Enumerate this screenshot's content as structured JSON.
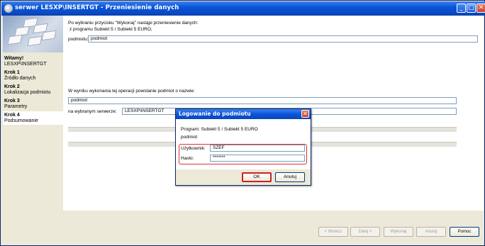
{
  "window": {
    "title": "serwer LESXP\\INSERTGT - Przeniesienie danych"
  },
  "sidebar": {
    "welcome_title": "Witamy!",
    "welcome_sub": "LESXP\\INSERTGT",
    "steps": [
      {
        "title": "Krok 1",
        "label": "Źródło danych"
      },
      {
        "title": "Krok 2",
        "label": "Lokalizacja podmiotu"
      },
      {
        "title": "Krok 3",
        "label": "Parametry"
      },
      {
        "title": "Krok 4",
        "label": "Podsumowanie"
      }
    ],
    "active_step": 4
  },
  "main": {
    "intro_line": "Po wybraniu przycisku \"Wykonaj\" nastąpi przeniesienie danych:",
    "source_line": "z programu Subiekt 5 / Subiekt 5 EURO,",
    "podmiot_label": "podmiotu:",
    "podmiot_value": "podmiot",
    "result_line": "W wyniku wykonania tej operacji powstanie podmiot o nazwie:",
    "new_name_value": "podmiot",
    "server_label": "na wybranym serwerze:",
    "server_value": "LESXP\\INSERTGT"
  },
  "nav": {
    "back": "< Wstecz",
    "next": "Dalej >",
    "execute": "Wykonaj",
    "cancel": "Anuluj",
    "help": "Pomoc"
  },
  "dialog": {
    "title": "Logowanie do podmiotu",
    "program_line": "Program: Subiekt 5 / Subiekt 5 EURO",
    "podmiot_line": "podmiot",
    "user_label": "Użytkownik:",
    "user_value": "SZEF",
    "password_label": "Hasło:",
    "password_value": "*******",
    "ok": "OK",
    "cancel": "Anuluj"
  },
  "colors": {
    "titlebar": "#0a55d8",
    "highlight_red": "#e03030"
  }
}
